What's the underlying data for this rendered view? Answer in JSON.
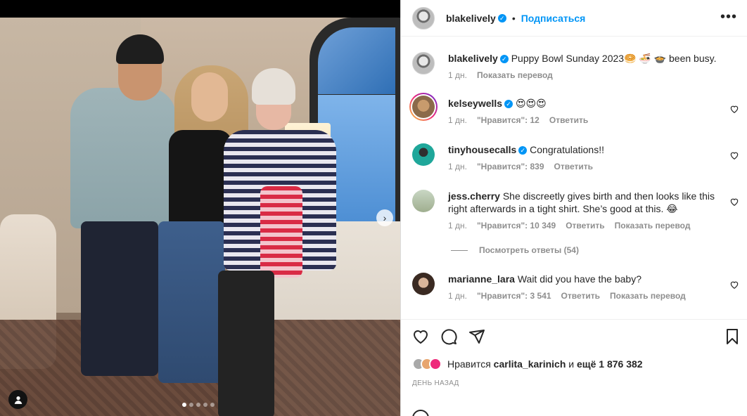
{
  "post": {
    "username": "blakelively",
    "follow_label": "Подписаться",
    "separator": "•",
    "more_label": "•••",
    "caption_text": "Puppy Bowl Sunday 2023🥯 🍜 🍲 been busy.",
    "caption_time": "1 дн.",
    "caption_translate": "Показать перевод"
  },
  "comments": [
    {
      "username": "kelseywells",
      "verified": true,
      "text": "😍😍😍",
      "time": "1 дн.",
      "likes": "\"Нравится\": 12",
      "reply": "Ответить",
      "translate": ""
    },
    {
      "username": "tinyhousecalls",
      "verified": true,
      "text": "Congratulations!!",
      "time": "1 дн.",
      "likes": "\"Нравится\": 839",
      "reply": "Ответить",
      "translate": ""
    },
    {
      "username": "jess.cherry",
      "verified": false,
      "text": "She discreetly gives birth and then looks like this right afterwards in a tight shirt. She’s good at this. 😂",
      "time": "1 дн.",
      "likes": "\"Нравится\": 10 349",
      "reply": "Ответить",
      "translate": "Показать перевод",
      "view_replies": "Посмотреть ответы (54)"
    },
    {
      "username": "marianne_lara",
      "verified": false,
      "text": "Wait did you have the baby?",
      "time": "1 дн.",
      "likes": "\"Нравится\": 3 541",
      "reply": "Ответить",
      "translate": "Показать перевод"
    }
  ],
  "likes_summary": {
    "prefix": "Нравится",
    "user": "carlita_karinich",
    "middle": "и",
    "rest": "ещё 1 876 382"
  },
  "date_label": "ДЕНЬ НАЗАД",
  "icons": {
    "heart": "heart-icon",
    "comment": "comment-icon",
    "share": "share-icon",
    "bookmark": "bookmark-icon",
    "more": "more-icon",
    "next": "chevron-right-icon",
    "tag": "user-tag-icon"
  },
  "colors": {
    "accent": "#0095f6",
    "text": "#262626",
    "muted": "#8e8e8e"
  }
}
